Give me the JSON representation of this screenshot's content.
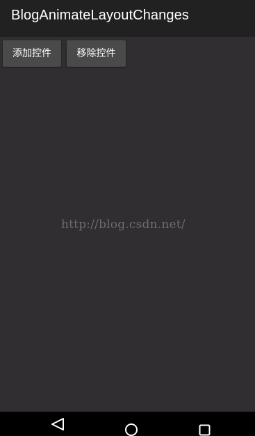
{
  "app_bar": {
    "title": "BlogAnimateLayoutChanges"
  },
  "toolbar": {
    "add_label": "添加控件",
    "remove_label": "移除控件"
  },
  "content": {
    "watermark": "http://blog.csdn.net/"
  },
  "nav_bar": {
    "back_icon": "back-triangle-icon",
    "home_icon": "home-circle-icon",
    "recent_icon": "recent-apps-square-icon"
  },
  "colors": {
    "app_bar": "#212121",
    "content_bg": "#302e30",
    "button_bg": "#4b4a4b",
    "nav_bar": "#000000",
    "text": "#ffffff"
  }
}
